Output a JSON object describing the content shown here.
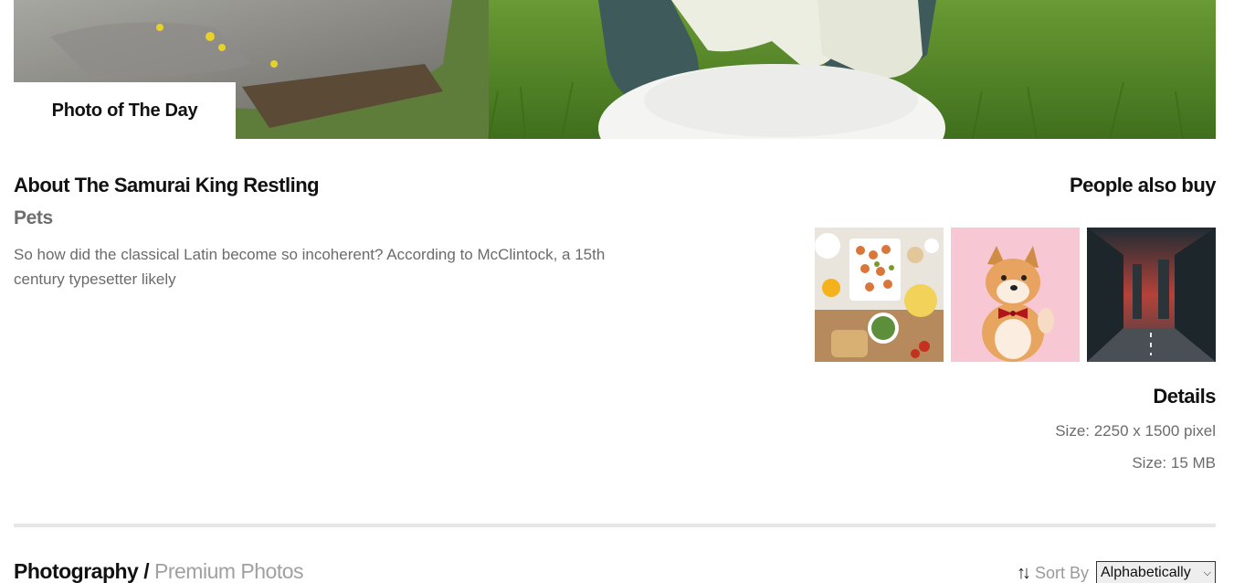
{
  "hero": {
    "badge_label": "Photo of The Day"
  },
  "about": {
    "title": "About The Samurai King Restling",
    "category": "Pets",
    "description": "So how did the classical Latin become so incoherent? According to McClintock, a 15th century typesetter likely"
  },
  "people_also_buy": {
    "title": "People also buy",
    "thumbnails": [
      "food-spread-thumbnail",
      "shiba-dog-thumbnail",
      "city-street-thumbnail"
    ]
  },
  "details": {
    "title": "Details",
    "dimensions": "Size: 2250 x 1500 pixel",
    "file_size": "Size: 15 MB"
  },
  "listing": {
    "breadcrumb_main": "Photography /",
    "breadcrumb_sub": "Premium Photos",
    "sort_icon": "↑↓",
    "sort_label": "Sort By",
    "sort_value": "Alphabetically"
  }
}
